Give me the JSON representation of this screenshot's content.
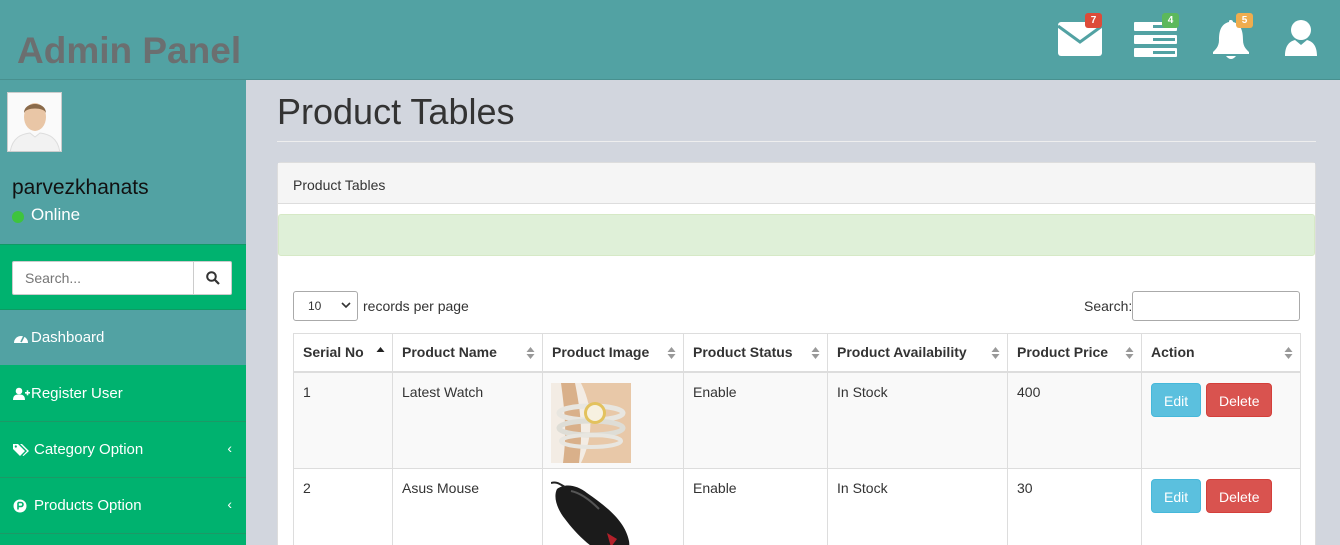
{
  "header": {
    "brand": "Admin Panel",
    "mail_count": "7",
    "tasks_count": "4",
    "alerts_count": "5",
    "colors": {
      "bar": "#52a2a3",
      "mail_badge": "#dd4b39",
      "tasks_badge": "#5cb85c",
      "alerts_badge": "#f0ad4e"
    }
  },
  "sidebar": {
    "username": "parvezkhanats",
    "status": "Online",
    "search_placeholder": "Search...",
    "menu": [
      {
        "label": "Dashboard",
        "icon": "tachometer-icon",
        "has_submenu": false
      },
      {
        "label": "Register User",
        "icon": "user-plus-icon",
        "has_submenu": false
      },
      {
        "label": "Category Option",
        "icon": "tags-icon",
        "has_submenu": true
      },
      {
        "label": "Products Option",
        "icon": "product-hunt-icon",
        "has_submenu": true
      }
    ],
    "chevron": "‹"
  },
  "main": {
    "page_title": "Product Tables",
    "panel_title": "Product Tables",
    "length_value": "10",
    "length_label": "records per page",
    "search_label": "Search:",
    "columns": [
      "Serial No",
      "Product Name",
      "Product Image",
      "Product Status",
      "Product Availability",
      "Product Price",
      "Action"
    ],
    "rows": [
      {
        "serial": "1",
        "name": "Latest Watch",
        "image": "watch-image",
        "status": "Enable",
        "availability": "In Stock",
        "price": "400"
      },
      {
        "serial": "2",
        "name": "Asus Mouse",
        "image": "mouse-image",
        "status": "Enable",
        "availability": "In Stock",
        "price": "30"
      }
    ],
    "edit_label": "Edit",
    "delete_label": "Delete"
  }
}
